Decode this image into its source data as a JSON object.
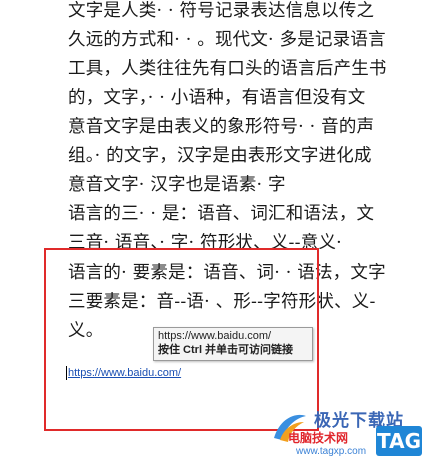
{
  "document": {
    "lines": [
      "文字是人类· · 符号记录表达信息以传之",
      "久远的方式和· · 。现代文· 多是记录语言",
      "工具，人类往往先有口头的语言后产生书",
      "的，文字，· · 小语种，有语言但没有文",
      "意音文字是由表义的象形符号· · 音的声",
      "组。· 的文字，汉字是由表形文字进化成",
      "意音文字· 汉字也是语素· 字",
      "语言的三· · 是：语音、词汇和语法，文",
      "三音· 语音、· 字· 符形状、义--意义·",
      "语言的· 要素是：语音、词· · 语法，文字",
      "三要素是：音--语· 、形--字符形状、义-",
      "义。"
    ]
  },
  "tooltip": {
    "url": "https://www.baidu.com/",
    "hint": "按住 Ctrl 并单击可访问链接"
  },
  "hyperlink": {
    "text": "https://www.baidu.com/"
  },
  "watermark": {
    "title": "极光下载站",
    "subtitle": "电脑技术网",
    "url": "www.tagxp.com",
    "tag": "TAG"
  },
  "colors": {
    "highlight_box": "#e02a2a",
    "link": "#1a4fb3"
  }
}
